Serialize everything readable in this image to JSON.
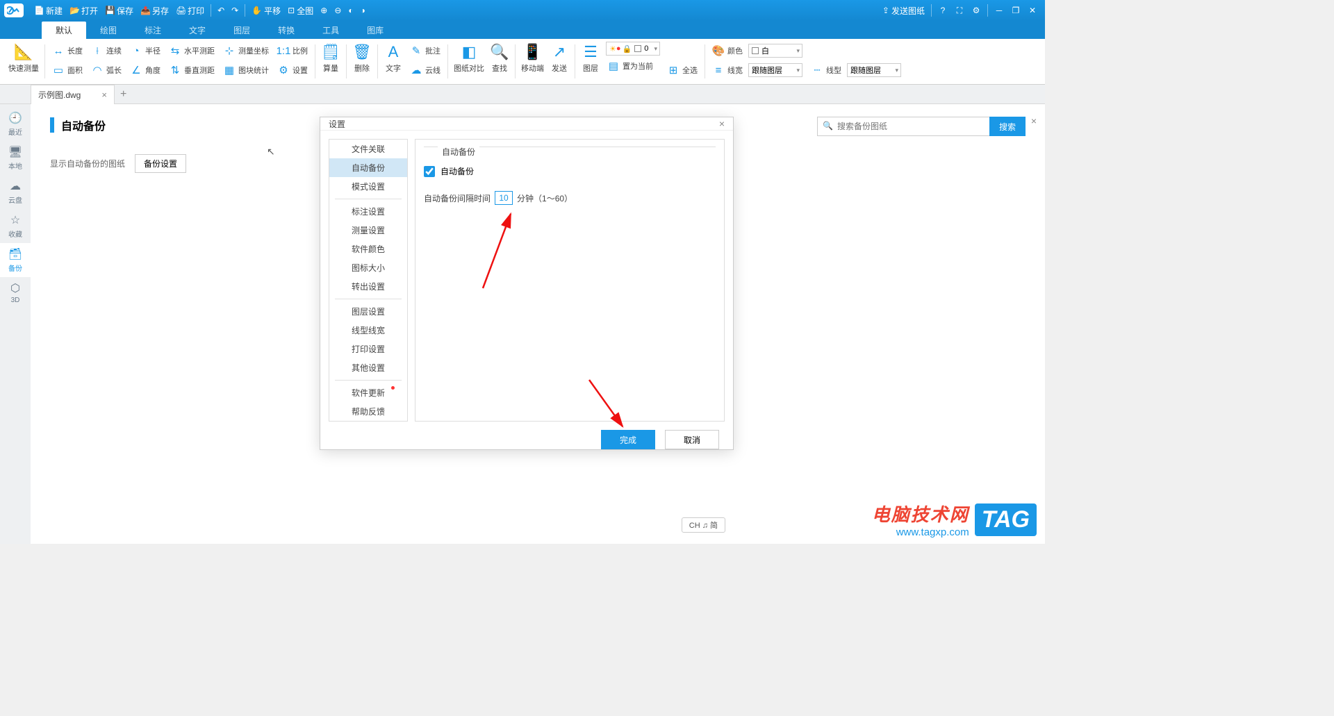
{
  "titlebar": {
    "new": "新建",
    "open": "打开",
    "save": "保存",
    "saveas": "另存",
    "print": "打印",
    "pan": "平移",
    "full": "全图",
    "send_drawing": "发送图纸"
  },
  "menu": {
    "tabs": [
      "默认",
      "绘图",
      "标注",
      "文字",
      "图层",
      "转换",
      "工具",
      "图库"
    ],
    "active": 0
  },
  "ribbon": {
    "quick_measure": "快速测量",
    "length": "长度",
    "continuous": "连续",
    "radius": "半径",
    "hdistance": "水平测距",
    "meas_coord": "测量坐标",
    "scale": "比例",
    "area": "面积",
    "arc": "弧长",
    "angle": "角度",
    "vdistance": "垂直测距",
    "block_stats": "图块统计",
    "settings": "设置",
    "calc": "算量",
    "delete": "删除",
    "text": "文字",
    "annotate": "批注",
    "cloud": "云线",
    "compare": "图纸对比",
    "find": "查找",
    "mobile": "移动端",
    "send": "发送",
    "layer": "图层",
    "set_current": "置为当前",
    "select_all": "全选",
    "color": "颜色",
    "color_val": "白",
    "lineweight": "线宽",
    "lineweight_val": "跟随图层",
    "linetype": "线型",
    "linetype_val": "跟随图层",
    "layer_sel": "0"
  },
  "doctab": {
    "name": "示例图.dwg"
  },
  "sidebar": {
    "items": [
      {
        "label": "最近"
      },
      {
        "label": "本地"
      },
      {
        "label": "云盘"
      },
      {
        "label": "收藏"
      },
      {
        "label": "备份"
      },
      {
        "label": "3D"
      }
    ],
    "active": 4
  },
  "page": {
    "title": "自动备份",
    "show_backup": "显示自动备份的图纸",
    "backup_settings": "备份设置"
  },
  "search": {
    "placeholder": "搜索备份图纸",
    "btn": "搜索"
  },
  "dialog": {
    "title": "设置",
    "nav": [
      "文件关联",
      "自动备份",
      "模式设置",
      "标注设置",
      "测量设置",
      "软件颜色",
      "图标大小",
      "转出设置",
      "图层设置",
      "线型线宽",
      "打印设置",
      "其他设置",
      "软件更新",
      "帮助反馈"
    ],
    "nav_active": 1,
    "section": "自动备份",
    "checkbox": "自动备份",
    "interval_label": "自动备份间隔时间",
    "interval_value": "10",
    "interval_unit": "分钟（1～60）",
    "ok": "完成",
    "cancel": "取消"
  },
  "status": "CH ♫ 简",
  "watermark": {
    "line1": "电脑技术网",
    "line2": "www.tagxp.com",
    "tag": "TAG"
  }
}
